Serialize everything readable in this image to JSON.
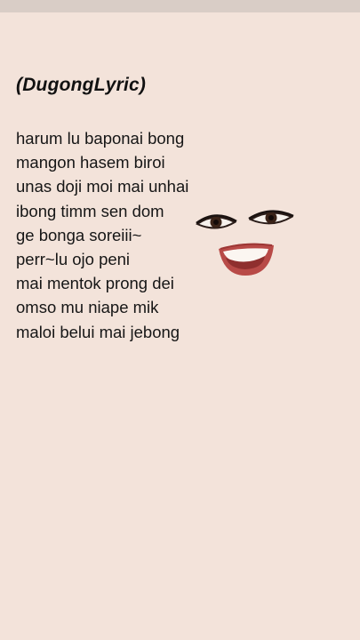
{
  "note": {
    "title": "(DugongLyric)",
    "lines": [
      "harum lu baponai bong",
      "mangon hasem biroi",
      "unas doji moi mai unhai",
      "ibong timm sen dom",
      "ge bonga soreiii~",
      "perr~lu ojo peni",
      "mai mentok prong dei",
      "omso mu niape mik",
      "maloi belui mai jebong"
    ]
  },
  "colors": {
    "background": "#f3e3da",
    "text": "#161616",
    "top_bar": "#d9cdc6",
    "lips": "#b84a47"
  },
  "icons": {
    "face": "smiling-face-sticker"
  }
}
